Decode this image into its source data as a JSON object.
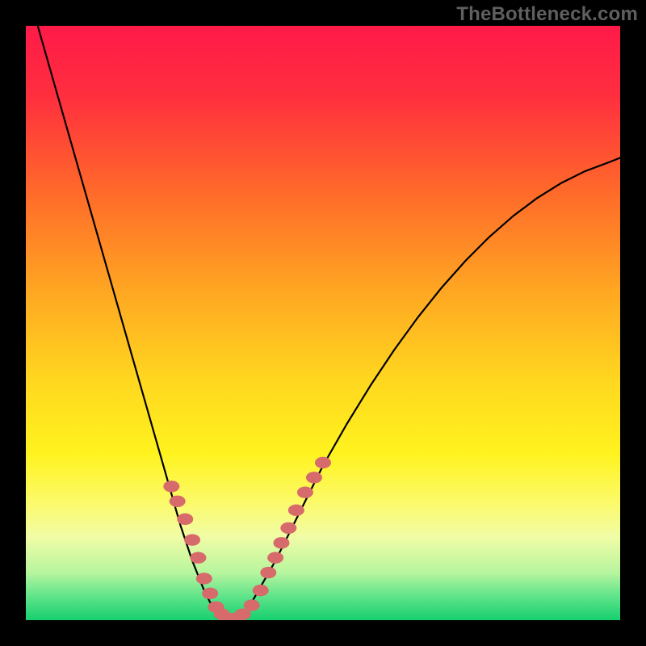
{
  "watermark": "TheBottleneck.com",
  "colors": {
    "frame": "#000000",
    "watermark_text": "#5f5f5f",
    "gradient_stops": [
      {
        "offset": 0.0,
        "color": "#ff1a49"
      },
      {
        "offset": 0.12,
        "color": "#ff2f3e"
      },
      {
        "offset": 0.28,
        "color": "#ff6a2a"
      },
      {
        "offset": 0.45,
        "color": "#ffa822"
      },
      {
        "offset": 0.6,
        "color": "#ffd81f"
      },
      {
        "offset": 0.72,
        "color": "#fff31f"
      },
      {
        "offset": 0.8,
        "color": "#fcfa68"
      },
      {
        "offset": 0.86,
        "color": "#f1fca6"
      },
      {
        "offset": 0.92,
        "color": "#b7f59e"
      },
      {
        "offset": 0.96,
        "color": "#5fe48a"
      },
      {
        "offset": 1.0,
        "color": "#17cf6f"
      }
    ],
    "curve": "#000000",
    "marker_fill": "#d76a6a",
    "marker_stroke": "#d76a6a"
  },
  "chart_data": {
    "type": "line",
    "title": "",
    "xlabel": "",
    "ylabel": "",
    "xlim": [
      0,
      1
    ],
    "ylim": [
      0,
      1
    ],
    "grid": false,
    "legend": false,
    "series": [
      {
        "name": "bottleneck-curve",
        "x": [
          0.0,
          0.02,
          0.04,
          0.06,
          0.08,
          0.1,
          0.12,
          0.14,
          0.16,
          0.18,
          0.2,
          0.22,
          0.24,
          0.26,
          0.28,
          0.3,
          0.31,
          0.32,
          0.33,
          0.34,
          0.35,
          0.36,
          0.37,
          0.38,
          0.4,
          0.42,
          0.44,
          0.46,
          0.48,
          0.5,
          0.54,
          0.58,
          0.62,
          0.66,
          0.7,
          0.74,
          0.78,
          0.82,
          0.86,
          0.9,
          0.94,
          0.98,
          1.0
        ],
        "y": [
          1.07,
          1.0,
          0.93,
          0.86,
          0.79,
          0.72,
          0.65,
          0.58,
          0.51,
          0.44,
          0.37,
          0.3,
          0.23,
          0.16,
          0.1,
          0.05,
          0.03,
          0.015,
          0.005,
          0.0,
          0.0,
          0.005,
          0.015,
          0.03,
          0.065,
          0.1,
          0.14,
          0.18,
          0.22,
          0.26,
          0.33,
          0.395,
          0.455,
          0.51,
          0.56,
          0.605,
          0.645,
          0.68,
          0.71,
          0.735,
          0.755,
          0.77,
          0.778
        ]
      }
    ],
    "markers": {
      "name": "highlighted-points",
      "x": [
        0.245,
        0.255,
        0.268,
        0.28,
        0.29,
        0.3,
        0.31,
        0.32,
        0.33,
        0.34,
        0.352,
        0.365,
        0.38,
        0.395,
        0.408,
        0.42,
        0.43,
        0.442,
        0.455,
        0.47,
        0.485,
        0.5
      ],
      "y": [
        0.225,
        0.2,
        0.17,
        0.135,
        0.105,
        0.07,
        0.045,
        0.022,
        0.01,
        0.003,
        0.003,
        0.01,
        0.025,
        0.05,
        0.08,
        0.105,
        0.13,
        0.155,
        0.185,
        0.215,
        0.24,
        0.265
      ],
      "size": 10
    }
  }
}
